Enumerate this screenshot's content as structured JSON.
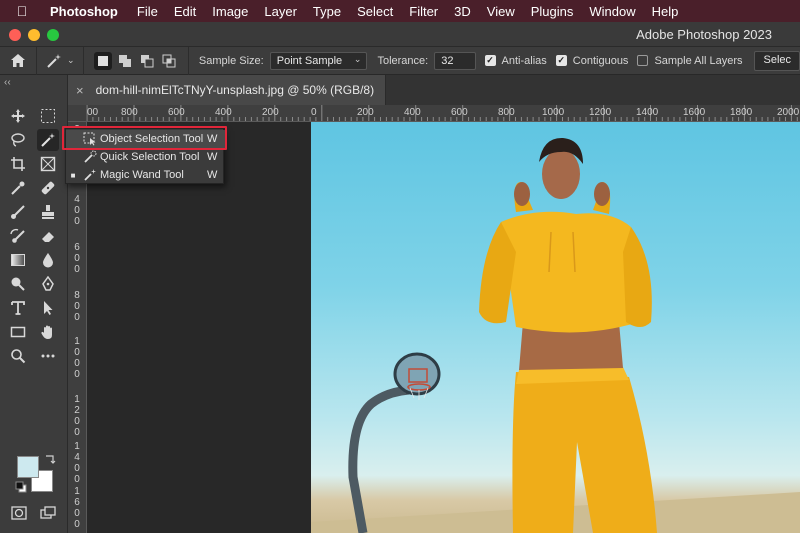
{
  "menubar": {
    "app": "Photoshop",
    "items": [
      "File",
      "Edit",
      "Image",
      "Layer",
      "Type",
      "Select",
      "Filter",
      "3D",
      "View",
      "Plugins",
      "Window",
      "Help"
    ]
  },
  "window": {
    "title": "Adobe Photoshop 2023"
  },
  "options": {
    "sample_size_label": "Sample Size:",
    "sample_size_value": "Point Sample",
    "tolerance_label": "Tolerance:",
    "tolerance_value": "32",
    "anti_alias_label": "Anti-alias",
    "anti_alias_checked": true,
    "contiguous_label": "Contiguous",
    "contiguous_checked": true,
    "sample_all_layers_label": "Sample All Layers",
    "sample_all_layers_checked": false,
    "select_subject_label": "Selec"
  },
  "panel": {
    "collapse_label": "‹‹"
  },
  "document": {
    "tab_title": "dom-hill-nimElTcTNyY-unsplash.jpg @ 50% (RGB/8)",
    "close_label": "×"
  },
  "rulers": {
    "horizontal": [
      "00",
      "800",
      "600",
      "400",
      "200",
      "0",
      "200",
      "400",
      "600",
      "800",
      "1000",
      "1200",
      "1400",
      "1600",
      "1800",
      "2000",
      "22"
    ],
    "vertical": [
      "2",
      "0",
      "4\n0\n0",
      "6\n0\n0",
      "8\n0\n0",
      "1\n0\n0\n0",
      "1\n2\n0\n0",
      "1\n4\n0\n0",
      "1\n6\n0\n0",
      "1\n8\n0\n0"
    ]
  },
  "flyout": {
    "items": [
      {
        "name": "Object Selection Tool",
        "key": "W",
        "active": false
      },
      {
        "name": "Quick Selection Tool",
        "key": "W",
        "active": false
      },
      {
        "name": "Magic Wand Tool",
        "key": "W",
        "active": true
      }
    ]
  },
  "colors": {
    "menubar_bg": "#4a1f2a",
    "foreground_swatch": "#cde9ef",
    "background_swatch": "#ffffff",
    "highlight_outline": "#e0263a",
    "hoodie": "#f2b31c"
  },
  "icons": {
    "tools": [
      "move-icon",
      "marquee-icon",
      "lasso-icon",
      "magic-wand-icon",
      "crop-icon",
      "frame-icon",
      "eyedropper-icon",
      "healing-brush-icon",
      "brush-icon",
      "clone-stamp-icon",
      "history-brush-icon",
      "eraser-icon",
      "gradient-icon",
      "blur-icon",
      "dodge-icon",
      "pen-icon",
      "type-icon",
      "path-selection-icon",
      "rectangle-icon",
      "hand-icon",
      "zoom-icon",
      "more-tools-icon",
      "quick-mask-icon",
      "screen-mode-icon"
    ]
  }
}
